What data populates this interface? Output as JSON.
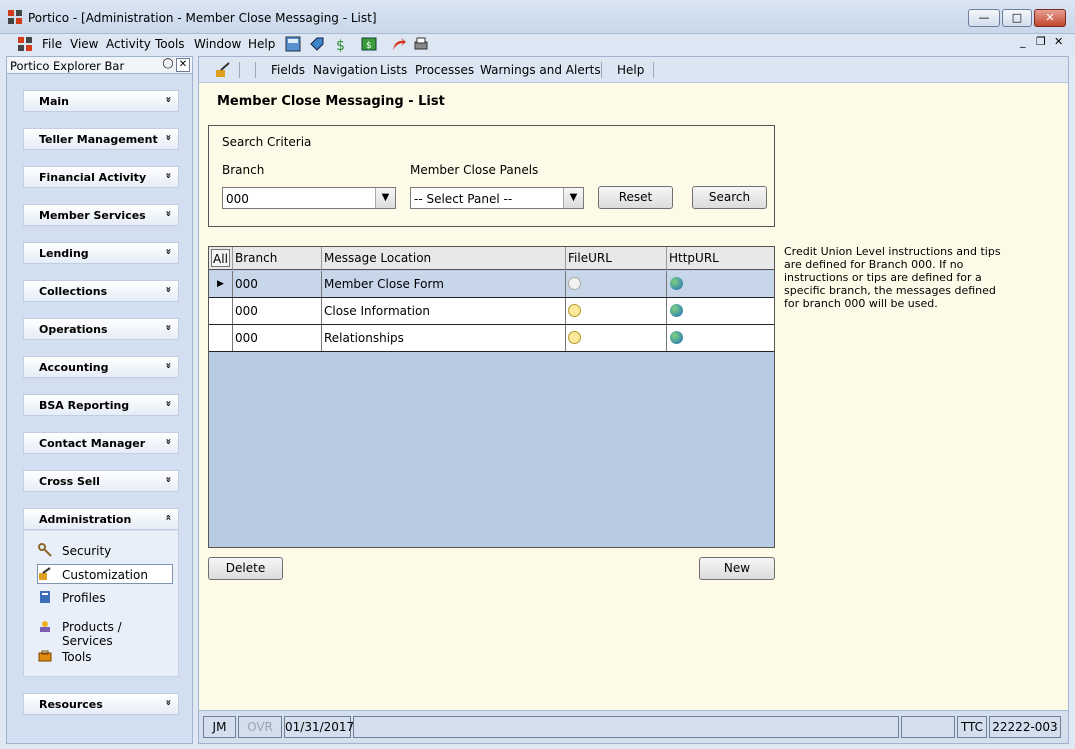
{
  "window": {
    "title": "Portico - [Administration - Member Close Messaging - List]",
    "minimize": "—",
    "maximize": "□",
    "close": "✕"
  },
  "menubar": {
    "items": [
      "File",
      "View",
      "Activity",
      "Tools",
      "Window",
      "Help"
    ],
    "mdi_min": "_",
    "mdi_restore": "❐",
    "mdi_close": "✕"
  },
  "explorer": {
    "title": "Portico Explorer Bar",
    "sections": [
      "Main",
      "Teller Management",
      "Financial Activity",
      "Member Services",
      "Lending",
      "Collections",
      "Operations",
      "Accounting",
      "BSA Reporting",
      "Contact Manager",
      "Cross Sell",
      "Administration",
      "Resources"
    ],
    "collapse_glyph": "»",
    "expand_glyph": "«",
    "admin_items": [
      {
        "label": "Security",
        "icon": "security-key-icon"
      },
      {
        "label": "Customization",
        "icon": "customization-icon"
      },
      {
        "label": "Profiles",
        "icon": "profiles-icon"
      },
      {
        "label": "Products / Services",
        "icon": "products-icon"
      },
      {
        "label": "Tools",
        "icon": "tools-icon"
      }
    ]
  },
  "subbar": {
    "items": [
      "Fields",
      "Navigation",
      "Lists",
      "Processes",
      "Warnings and Alerts",
      "Help"
    ]
  },
  "page": {
    "title": "Member Close Messaging - List",
    "criteria_title": "Search Criteria",
    "branch_label": "Branch",
    "branch_value": "000",
    "panels_label": "Member Close Panels",
    "panels_value": "-- Select Panel --",
    "reset_label": "Reset",
    "search_label": "Search",
    "delete_label": "Delete",
    "new_label": "New",
    "note": "Credit Union Level instructions and tips are defined for Branch 000. If no instructions or tips are defined for a specific branch, the messages defined for branch 000 will be used."
  },
  "grid": {
    "headers": [
      "All",
      "Branch",
      "Message Location",
      "FileURL",
      "HttpURL"
    ],
    "rows": [
      {
        "branch": "000",
        "location": "Member Close Form"
      },
      {
        "branch": "000",
        "location": "Close Information"
      },
      {
        "branch": "000",
        "location": "Relationships"
      }
    ]
  },
  "status": {
    "user": "JM",
    "ovr": "OVR",
    "date": "01/31/2017",
    "ttc": "TTC",
    "code": "22222-003"
  },
  "colors": {
    "accent": "#c2452c",
    "grid_bg": "#b9cbe3",
    "main_bg": "#fdfbe7"
  }
}
